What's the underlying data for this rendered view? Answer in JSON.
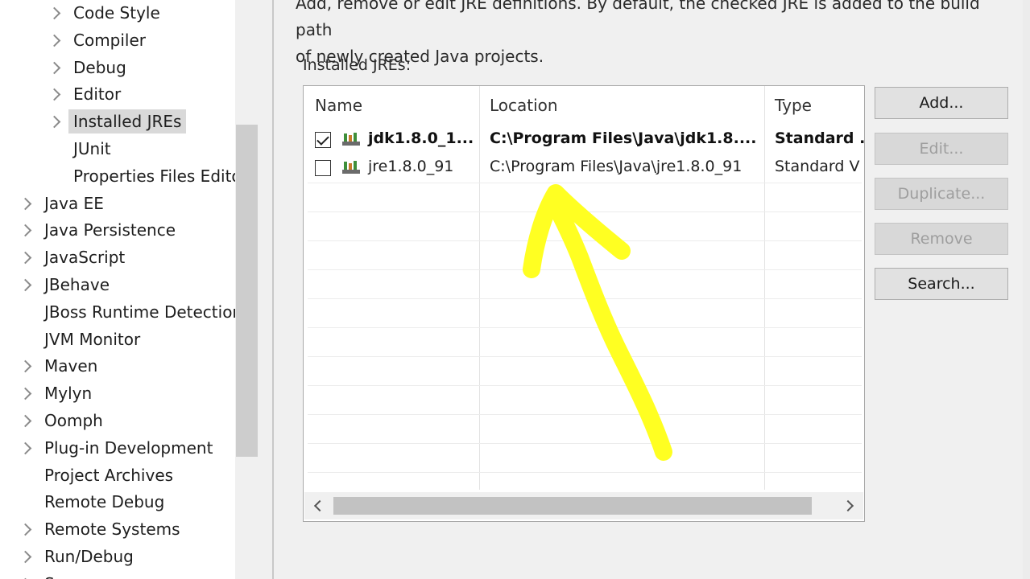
{
  "tree": {
    "sub_items": [
      {
        "label": "Code Style",
        "has_children": true
      },
      {
        "label": "Compiler",
        "has_children": true
      },
      {
        "label": "Debug",
        "has_children": true
      },
      {
        "label": "Editor",
        "has_children": true
      },
      {
        "label": "Installed JREs",
        "has_children": true,
        "selected": true
      },
      {
        "label": "JUnit",
        "has_children": false
      },
      {
        "label": "Properties Files Edito",
        "has_children": false
      }
    ],
    "top_items": [
      {
        "label": "Java EE",
        "has_children": true
      },
      {
        "label": "Java Persistence",
        "has_children": true
      },
      {
        "label": "JavaScript",
        "has_children": true
      },
      {
        "label": "JBehave",
        "has_children": true
      },
      {
        "label": "JBoss Runtime Detection",
        "has_children": false
      },
      {
        "label": "JVM Monitor",
        "has_children": false
      },
      {
        "label": "Maven",
        "has_children": true
      },
      {
        "label": "Mylyn",
        "has_children": true
      },
      {
        "label": "Oomph",
        "has_children": true
      },
      {
        "label": "Plug-in Development",
        "has_children": true
      },
      {
        "label": "Project Archives",
        "has_children": false
      },
      {
        "label": "Remote Debug",
        "has_children": false
      },
      {
        "label": "Remote Systems",
        "has_children": true
      },
      {
        "label": "Run/Debug",
        "has_children": true
      },
      {
        "label": "Server",
        "has_children": true
      }
    ]
  },
  "pane": {
    "description_line1": "Add, remove or edit JRE definitions. By default, the checked JRE is added to the build path",
    "description_line2": "of newly created Java projects.",
    "installed_label": "Installed JREs:"
  },
  "table": {
    "columns": [
      "Name",
      "Location",
      "Type"
    ],
    "rows": [
      {
        "checked": true,
        "name": "jdk1.8.0_1...",
        "location": "C:\\Program Files\\Java\\jdk1.8....",
        "type": "Standard ...",
        "bold": true
      },
      {
        "checked": false,
        "name": "jre1.8.0_91",
        "location": "C:\\Program Files\\Java\\jre1.8.0_91",
        "type": "Standard V",
        "bold": false
      }
    ]
  },
  "buttons": [
    {
      "label": "Add...",
      "enabled": true
    },
    {
      "label": "Edit...",
      "enabled": false
    },
    {
      "label": "Duplicate...",
      "enabled": false
    },
    {
      "label": "Remove",
      "enabled": false
    },
    {
      "label": "Search...",
      "enabled": true
    }
  ],
  "colors": {
    "annotation_arrow": "#ffff22",
    "jre_icon_green": "#3f8f3a",
    "jre_icon_orange": "#c97a2a"
  }
}
